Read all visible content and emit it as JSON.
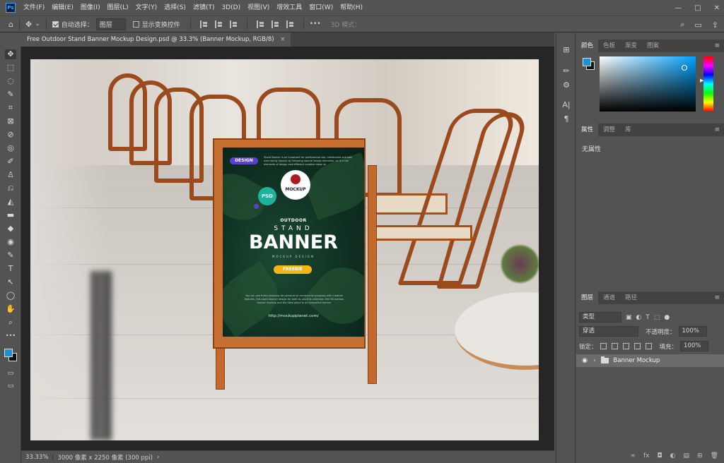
{
  "app": {
    "logo": "Ps"
  },
  "menu": [
    "文件(F)",
    "编辑(E)",
    "图像(I)",
    "图层(L)",
    "文字(Y)",
    "选择(S)",
    "滤镜(T)",
    "3D(D)",
    "视图(V)",
    "增效工具",
    "窗口(W)",
    "帮助(H)"
  ],
  "window_controls": {
    "minimize": "—",
    "maximize": "□",
    "close": "✕"
  },
  "options": {
    "auto_select_label": "自动选择：",
    "auto_select_value": "图层",
    "show_transform_label": "显示变换控件",
    "more": "•••",
    "mode_3d_label": "3D 模式："
  },
  "document": {
    "tab_title": "Free Outdoor Stand Banner Mockup Design.psd @ 33.3% (Banner Mockup, RGB/8)",
    "tab_close": "×"
  },
  "status": {
    "zoom": "33.33%",
    "info": "3000 像素 x 2250 像素 (300 ppi)",
    "arrow": "›"
  },
  "panels": {
    "color_tabs": [
      "颜色",
      "色板",
      "渐变",
      "图案"
    ],
    "props_tabs": [
      "属性",
      "调整",
      "库"
    ],
    "props_empty": "无属性",
    "layers_tabs": [
      "图层",
      "通道",
      "路径"
    ],
    "menu_glyph": "≡",
    "filter_kind": "类型",
    "blend_mode": "穿透",
    "opacity_label": "不透明度：",
    "opacity_value": "100%",
    "lock_label": "锁定：",
    "fill_label": "填充：",
    "fill_value": "100%",
    "layer_name": "Banner Mockup"
  },
  "poster": {
    "design_pill": "DESIGN",
    "tiny_text": "Stand Banner is an important for professional use, maintained and add new trendy layouts by following special design elements. As it is the elements of design and different creative ideas so",
    "badge_text": "MOCKUP",
    "psd_badge": "PSD",
    "outdoor": "OUTDOOR",
    "stand": "STAND",
    "banner": "BANNER",
    "mockup_design": "MOCKUP DESIGN",
    "freebie": "FREEBIE",
    "body_text": "You can use these mockups for personal or commercial purposes with creative features, this stand banner design for both to you this collection free fill outdoor banner mockup and the ideal place to an innovative banner",
    "url": "http://mockupplanet.com/"
  },
  "icons": {
    "home": "⌂",
    "move": "✥",
    "chevron": "⌄",
    "search": "⌕",
    "workspace": "▭",
    "share": "⇪",
    "tools": [
      "✥",
      "⬚",
      "◌",
      "✎",
      "⌗",
      "⊠",
      "⊘",
      "◎",
      "✐",
      "♙",
      "⎌",
      "◭",
      "▬",
      "◆",
      "◉",
      "✎",
      "T",
      "↖",
      "◯",
      "✋",
      "⌕",
      "•••"
    ],
    "mid": [
      "⊞",
      "✏",
      "⚙",
      "A|",
      "¶"
    ],
    "filter": [
      "▣",
      "◐",
      "T",
      "⬚",
      "●"
    ],
    "locks": [
      "⬚",
      "✎",
      "✥",
      "⬚",
      "🔒"
    ],
    "eye": "◉",
    "expand": "›",
    "footer": [
      "∞",
      "fx",
      "◘",
      "◐",
      "▤",
      "⊞",
      "🗑"
    ]
  }
}
